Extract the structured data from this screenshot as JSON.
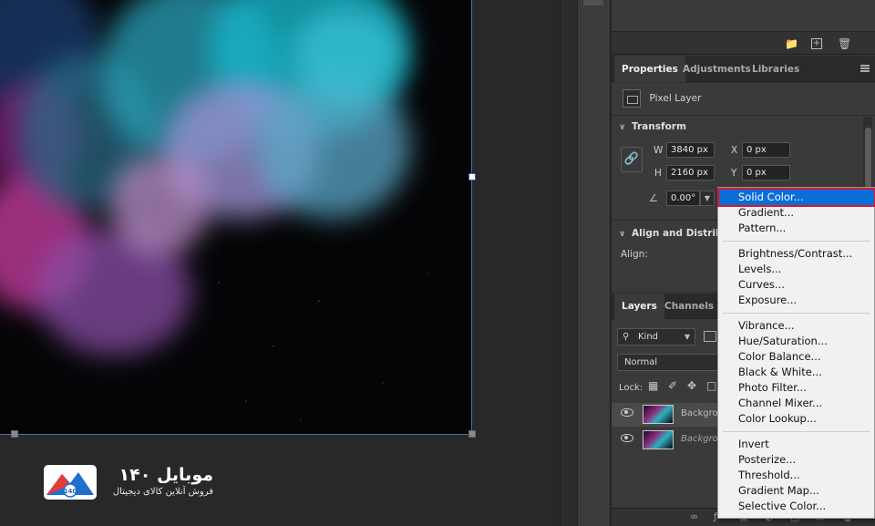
{
  "watermark": {
    "brand": "موبایل ۱۴۰",
    "tagline": "فروش آنلاین کالای دیجیتال",
    "logo_badge": "140"
  },
  "properties": {
    "tabs": [
      "Properties",
      "Adjustments",
      "Libraries"
    ],
    "active_tab": "Properties",
    "layer_kind": "Pixel Layer",
    "transform_title": "Transform",
    "w_label": "W",
    "w_value": "3840 px",
    "h_label": "H",
    "h_value": "2160 px",
    "x_label": "X",
    "x_value": "0 px",
    "y_label": "Y",
    "y_value": "0 px",
    "angle_value": "0.00°",
    "align_title": "Align and Distribut",
    "align_label": "Align:"
  },
  "layers": {
    "tabs": [
      "Layers",
      "Channels"
    ],
    "filter_kind": "Kind",
    "blend_mode": "Normal",
    "lock_label": "Lock:",
    "rows": [
      {
        "name": "Backgrou",
        "selected": true
      },
      {
        "name": "Backgrou",
        "selected": false
      }
    ]
  },
  "context_menu": {
    "highlighted": "Solid Color...",
    "groups": [
      [
        "Solid Color...",
        "Gradient...",
        "Pattern..."
      ],
      [
        "Brightness/Contrast...",
        "Levels...",
        "Curves...",
        "Exposure..."
      ],
      [
        "Vibrance...",
        "Hue/Saturation...",
        "Color Balance...",
        "Black & White...",
        "Photo Filter...",
        "Channel Mixer...",
        "Color Lookup..."
      ],
      [
        "Invert",
        "Posterize...",
        "Threshold...",
        "Gradient Map...",
        "Selective Color..."
      ]
    ]
  },
  "colors": {
    "menu_highlight": "#0a6ed8",
    "annotation_box": "#e0162b",
    "panel_bg": "#3a3a3a"
  }
}
